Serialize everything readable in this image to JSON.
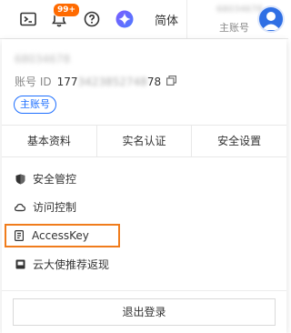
{
  "topbar": {
    "badge_count": "99+",
    "language": "简体",
    "account_id_short": "68034678",
    "role": "主账号"
  },
  "panel": {
    "account_name": "68034678",
    "id_label": "账号 ID",
    "id_prefix": "177",
    "id_middle": "3423852748",
    "id_suffix": "78",
    "role_tag": "主账号",
    "tabs": [
      {
        "label": "基本资料"
      },
      {
        "label": "实名认证"
      },
      {
        "label": "安全设置"
      }
    ],
    "menu": [
      {
        "label": "安全管控",
        "icon": "shield-icon"
      },
      {
        "label": "访问控制",
        "icon": "cloud-icon"
      },
      {
        "label": "AccessKey",
        "icon": "key-card-icon"
      },
      {
        "label": "云大使推荐返现",
        "icon": "book-icon"
      }
    ],
    "logout_label": "退出登录"
  },
  "colors": {
    "accent_blue": "#1e6fff",
    "badge_orange": "#ff6a00",
    "highlight_orange": "#f07c1c",
    "avatar_blue": "#2f6fe4"
  }
}
